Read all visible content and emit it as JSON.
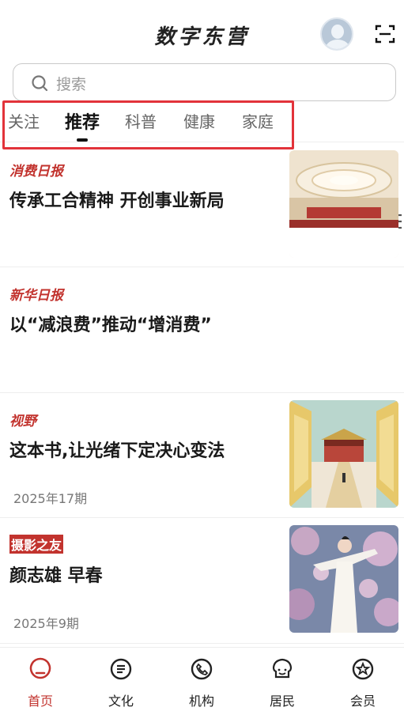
{
  "header": {
    "title": "数字东营"
  },
  "search": {
    "placeholder": "搜索"
  },
  "tabs": [
    {
      "label": "关注"
    },
    {
      "label": "推荐",
      "active": true
    },
    {
      "label": "科普"
    },
    {
      "label": "健康"
    },
    {
      "label": "家庭"
    }
  ],
  "articles": [
    {
      "source": "消费日报",
      "title": "传承工合精神 开创事业新局",
      "issue": "",
      "thumb": "conference-hall"
    },
    {
      "source": "新华日报",
      "title": "以“减浪费”推动“增消费”",
      "issue": ""
    },
    {
      "source": "视野",
      "title": "这本书,让光绪下定决心变法",
      "issue": "2025年17期",
      "thumb": "palace"
    },
    {
      "source": "摄影之友",
      "title": "颜志雄 早春",
      "issue": "2025年9期",
      "thumb": "dancer"
    }
  ],
  "tabbar": [
    {
      "label": "首页",
      "icon": "home-icon",
      "active": true
    },
    {
      "label": "文化",
      "icon": "culture-icon"
    },
    {
      "label": "机构",
      "icon": "phone-icon"
    },
    {
      "label": "居民",
      "icon": "resident-icon"
    },
    {
      "label": "会员",
      "icon": "member-icon"
    }
  ],
  "colors": {
    "accent": "#c2332e",
    "highlight": "#e2333a"
  }
}
